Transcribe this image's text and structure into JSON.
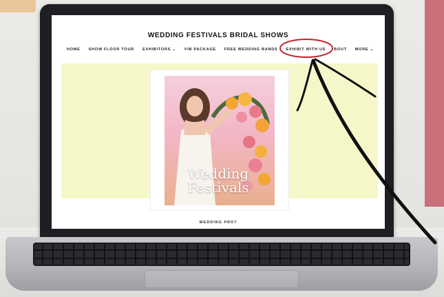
{
  "site": {
    "title": "WEDDING FESTIVALS BRIDAL SHOWS",
    "nav": [
      "HOME",
      "SHOW FLOOR TOUR",
      "EXHIBITORS ⌄",
      "VIB PACKAGE",
      "FREE WEDDING BANDS",
      "EXHIBIT WITH US",
      "BOUT",
      "MORE ⌄"
    ],
    "flyer_title_line1": "Wedding",
    "flyer_title_line2": "Festivals",
    "footer": "WEDDING PRO?"
  },
  "annotation": {
    "highlight_target": "EXHIBIT WITH US",
    "color": "#c8202a"
  }
}
